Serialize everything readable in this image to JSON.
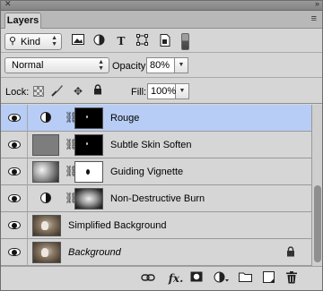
{
  "panel": {
    "tab_label": "Layers",
    "menu_icon": "panel-menu-icon"
  },
  "filter": {
    "kind_label": "Kind",
    "icons": [
      "pixel-filter-icon",
      "adjustment-filter-icon",
      "type-filter-icon",
      "shape-filter-icon",
      "smart-object-filter-icon"
    ]
  },
  "blend": {
    "mode": "Normal",
    "opacity_label": "Opacity:",
    "opacity_value": "80%"
  },
  "lock": {
    "label": "Lock:",
    "fill_label": "Fill:",
    "fill_value": "100%"
  },
  "layers": [
    {
      "name": "Rouge",
      "selected": true,
      "italic": false
    },
    {
      "name": "Subtle Skin Soften",
      "selected": false,
      "italic": false
    },
    {
      "name": "Guiding Vignette",
      "selected": false,
      "italic": false
    },
    {
      "name": "Non-Destructive Burn",
      "selected": false,
      "italic": false
    },
    {
      "name": "Simplified Background",
      "selected": false,
      "italic": false
    },
    {
      "name": "Background",
      "selected": false,
      "italic": true,
      "locked": true
    }
  ],
  "bottom_bar": {
    "fx_label": "fx.",
    "icons": [
      "link-layers-icon",
      "layer-style-icon",
      "add-mask-icon",
      "new-adjustment-layer-icon",
      "new-group-icon",
      "new-layer-icon",
      "delete-layer-icon"
    ]
  },
  "colors": {
    "selection": "#b8cdf5",
    "panel_bg": "#d6d6d6"
  }
}
